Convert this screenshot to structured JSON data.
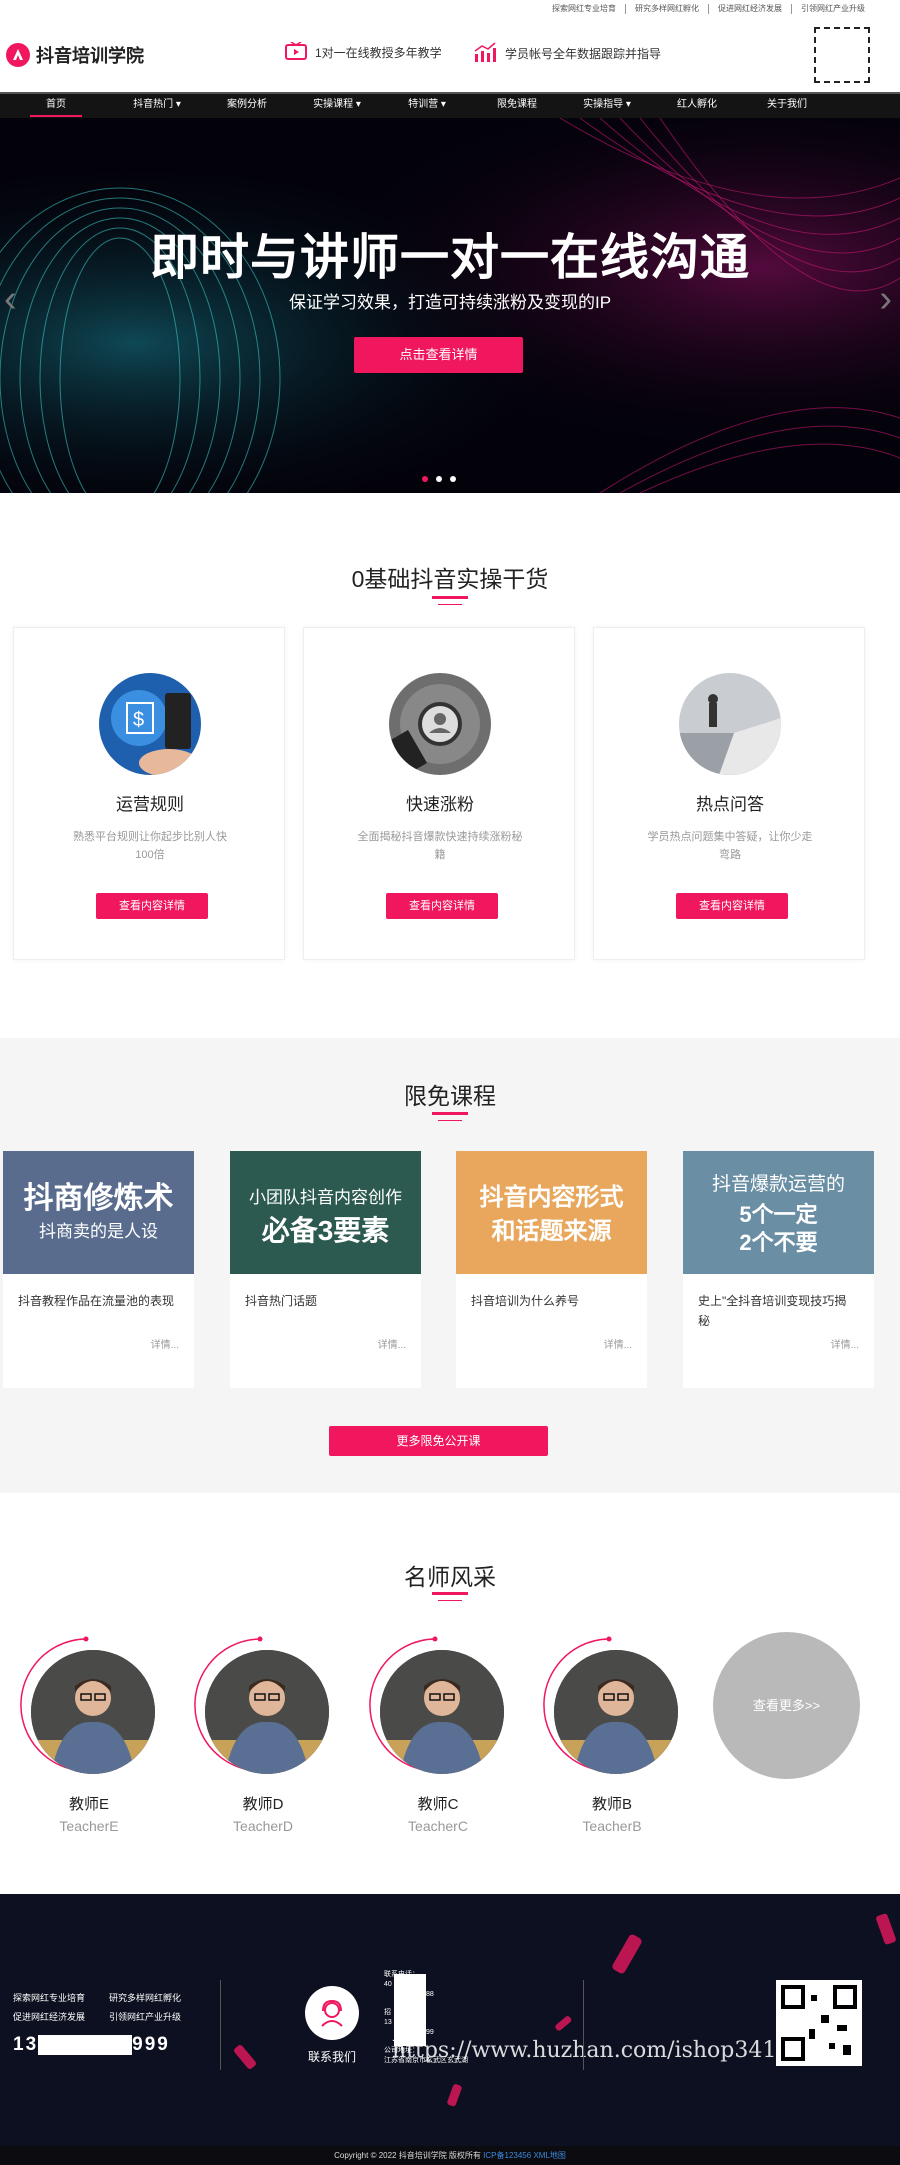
{
  "top_links": [
    "探索网红专业培育",
    "研究多样网红孵化",
    "促进网红经济发展",
    "引领网红产业升级"
  ],
  "header": {
    "logo_text": "抖音培训学院",
    "promo1": "1对一在线教授多年教学",
    "promo2": "学员帐号全年数据跟踪并指导"
  },
  "nav": [
    "首页",
    "抖音热门 ▾",
    "案例分析",
    "实操课程 ▾",
    "特训营 ▾",
    "限免课程",
    "实操指导 ▾",
    "红人孵化",
    "关于我们"
  ],
  "banner": {
    "title": "即时与讲师一对一在线沟通",
    "subtitle": "保证学习效果，打造可持续涨粉及变现的IP",
    "button": "点击查看详情"
  },
  "section1": {
    "heading": "0基础抖音实操干货",
    "cards": [
      {
        "title": "运营规则",
        "desc": "熟悉平台规则让你起步比别人快100倍",
        "button": "查看内容详情"
      },
      {
        "title": "快速涨粉",
        "desc": "全面揭秘抖音爆款快速持续涨粉秘籍",
        "button": "查看内容详情"
      },
      {
        "title": "热点问答",
        "desc": "学员热点问题集中答疑，让你少走弯路",
        "button": "查看内容详情"
      }
    ]
  },
  "section2": {
    "heading": "限免课程",
    "courses": [
      {
        "img_line1": "抖商修炼术",
        "img_line2": "抖商卖的是人设",
        "caption": "抖音教程作品在流量池的表现",
        "more": "详情..."
      },
      {
        "img_line1": "小团队抖音内容创作",
        "img_line2": "必备3要素",
        "caption": "抖音热门话题",
        "more": "详情..."
      },
      {
        "img_line1": "抖音内容形式",
        "img_line2": "和话题来源",
        "caption": "抖音培训为什么养号",
        "more": "详情..."
      },
      {
        "img_line1": "抖音爆款运营的",
        "img_line2": "5个一定",
        "img_line3": "2个不要",
        "caption": "史上\"全抖音培训变现技巧揭秘",
        "more": "详情..."
      }
    ],
    "more_button": "更多限免公开课"
  },
  "section3": {
    "heading": "名师风采",
    "teachers": [
      {
        "name": "教师E",
        "en": "TeacherE"
      },
      {
        "name": "教师D",
        "en": "TeacherD"
      },
      {
        "name": "教师C",
        "en": "TeacherC"
      },
      {
        "name": "教师B",
        "en": "TeacherB"
      }
    ],
    "see_more": "查看更多>>"
  },
  "footer": {
    "links": [
      "探索网红专业培育",
      "研究多样网红孵化",
      "促进网红经济发展",
      "引领网红产业升级"
    ],
    "phone_prefix": "13",
    "phone_suffix": "999",
    "contact_label": "联系我们",
    "info_lines": [
      "联系电话：",
      "40",
      "88",
      "招",
      "13",
      "99",
      "公司地址：",
      "江苏省南京市玄武区玄武湖"
    ],
    "watermark": "https://www.huzhan.com/ishop34101"
  },
  "bottom": {
    "copyright": "Copyright © 2022 抖音培训学院 版权所有",
    "icp": "ICP备123456",
    "xml": "XML地图"
  },
  "colors": {
    "accent": "#f0175f",
    "nav_bg": "#141414",
    "footer_bg": "#0d1020"
  }
}
